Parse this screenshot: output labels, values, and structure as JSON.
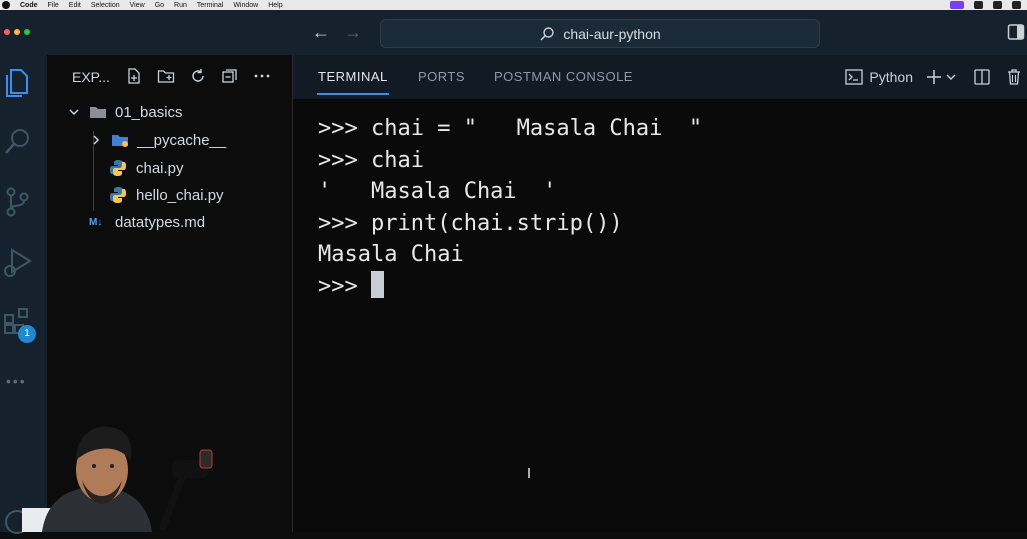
{
  "menubar": {
    "items": [
      "Code",
      "File",
      "Edit",
      "Selection",
      "View",
      "Go",
      "Run",
      "Terminal",
      "Window",
      "Help"
    ]
  },
  "titlebar": {
    "search_text": "chai-aur-python"
  },
  "activity": {
    "extensions_badge": "1"
  },
  "sidebar": {
    "header": "EXP...",
    "tree": [
      {
        "label": "01_basics",
        "type": "folder-open"
      },
      {
        "label": "__pycache__",
        "type": "folder"
      },
      {
        "label": "chai.py",
        "type": "python"
      },
      {
        "label": "hello_chai.py",
        "type": "python"
      },
      {
        "label": "datatypes.md",
        "type": "markdown",
        "icon_text": "M↓"
      }
    ]
  },
  "panel": {
    "tabs": [
      "TERMINAL",
      "PORTS",
      "POSTMAN CONSOLE"
    ],
    "active_tab": "TERMINAL",
    "shell_label": "Python"
  },
  "terminal": {
    "lines": [
      ">>> chai = \"   Masala Chai  \"",
      ">>> chai",
      "'   Masala Chai  '",
      ">>> print(chai.strip())",
      "Masala Chai"
    ],
    "prompt": ">>> "
  },
  "colors": {
    "accent": "#3b8eea",
    "badge": "#1f8ad2",
    "titlebar_bg": "#15212c",
    "terminal_bg": "#0a0a0a"
  }
}
